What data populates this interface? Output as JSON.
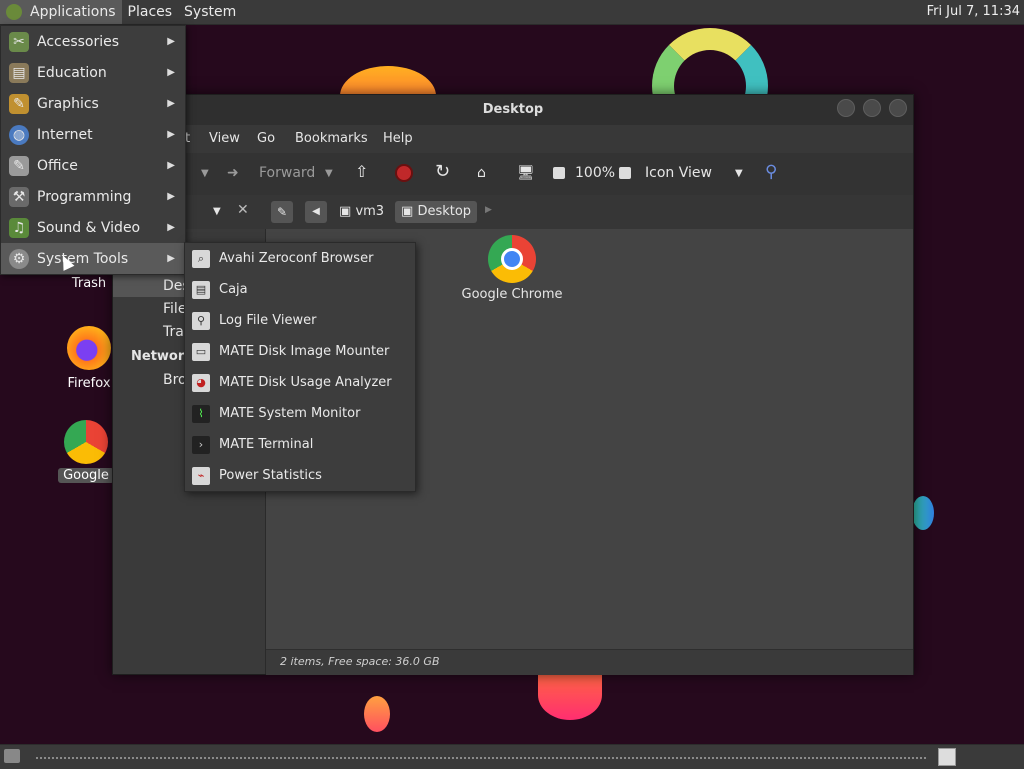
{
  "colors": {
    "desktop_bg": "#26091d",
    "panel_bg": "#3a3a3a",
    "menu_bg": "#3d3d3d",
    "menu_hover": "#5a5a5a",
    "window_bg": "#3c3c3c"
  },
  "top_panel": {
    "applications": "Applications",
    "places": "Places",
    "system": "System",
    "clock": "Fri Jul  7, 11:34"
  },
  "apps_menu": {
    "items": [
      {
        "label": "Accessories",
        "icon": "accessories-icon"
      },
      {
        "label": "Education",
        "icon": "education-icon"
      },
      {
        "label": "Graphics",
        "icon": "graphics-icon"
      },
      {
        "label": "Internet",
        "icon": "internet-icon"
      },
      {
        "label": "Office",
        "icon": "office-icon"
      },
      {
        "label": "Programming",
        "icon": "programming-icon"
      },
      {
        "label": "Sound & Video",
        "icon": "sound-video-icon"
      },
      {
        "label": "System Tools",
        "icon": "system-tools-icon"
      }
    ]
  },
  "system_tools_submenu": {
    "items": [
      {
        "label": "Avahi Zeroconf Browser"
      },
      {
        "label": "Caja"
      },
      {
        "label": "Log File Viewer"
      },
      {
        "label": "MATE Disk Image Mounter"
      },
      {
        "label": "MATE Disk Usage Analyzer"
      },
      {
        "label": "MATE System Monitor"
      },
      {
        "label": "MATE Terminal"
      },
      {
        "label": "Power Statistics"
      }
    ]
  },
  "desktop_icons": {
    "trash": "Trash",
    "firefox": "Firefox",
    "chrome": "Google"
  },
  "file_manager": {
    "title": "Desktop",
    "menus": [
      "t",
      "View",
      "Go",
      "Bookmarks",
      "Help"
    ],
    "toolbar": {
      "forward": "Forward",
      "zoom": "100%",
      "view_mode": "Icon View"
    },
    "location": {
      "crumb1": "vm3",
      "crumb2": "Desktop"
    },
    "sidebar": {
      "items": [
        "Des",
        "File",
        "Tra"
      ],
      "network_header": "Network",
      "network_items": [
        "Bro"
      ]
    },
    "content": {
      "items": [
        {
          "label": "Google Chrome"
        }
      ]
    },
    "status": "2 items, Free space: 36.0 GB"
  }
}
